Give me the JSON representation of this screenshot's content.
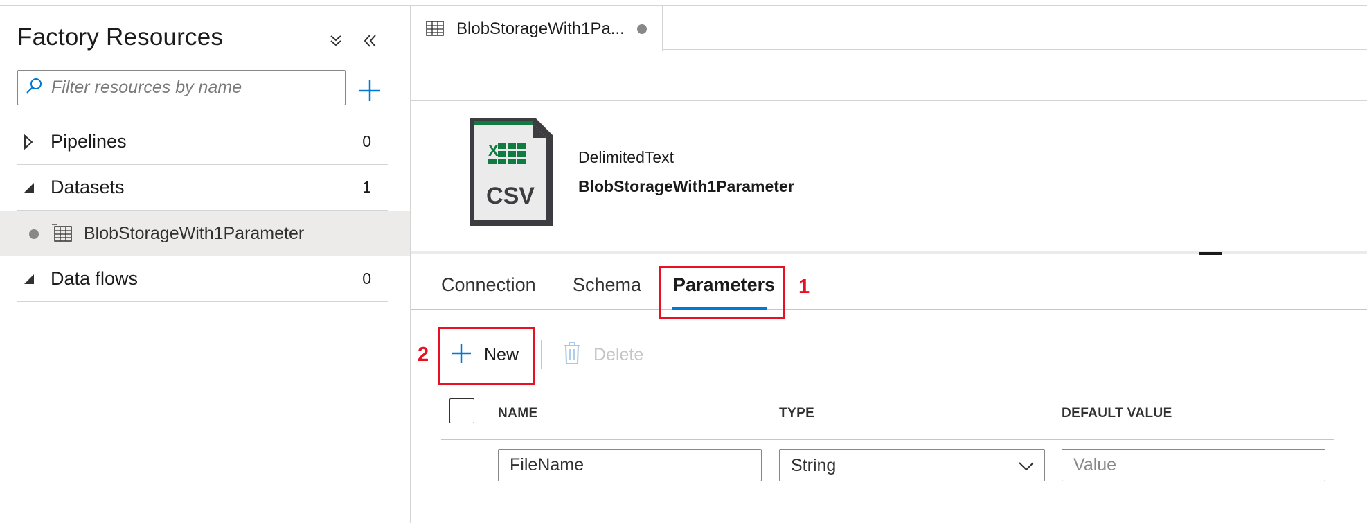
{
  "sidebar": {
    "title": "Factory Resources",
    "search_placeholder": "Filter resources by name",
    "sections": {
      "pipelines": {
        "label": "Pipelines",
        "count": "0"
      },
      "datasets": {
        "label": "Datasets",
        "count": "1"
      },
      "dataflows": {
        "label": "Data flows",
        "count": "0"
      }
    },
    "dataset_item": {
      "label": "BlobStorageWith1Parameter"
    }
  },
  "editor_tab": {
    "label": "BlobStorageWith1Pa..."
  },
  "dataset": {
    "icon_text": "CSV",
    "type": "DelimitedText",
    "name": "BlobStorageWith1Parameter"
  },
  "subtabs": {
    "connection": "Connection",
    "schema": "Schema",
    "parameters": "Parameters"
  },
  "annotations": {
    "one": "1",
    "two": "2"
  },
  "toolbar": {
    "new_label": "New",
    "delete_label": "Delete"
  },
  "grid": {
    "columns": {
      "name": "NAME",
      "type": "TYPE",
      "default": "DEFAULT VALUE"
    },
    "row": {
      "name_value": "FileName",
      "type_value": "String",
      "default_placeholder": "Value"
    }
  },
  "colors": {
    "accent": "#0078d4",
    "annotation": "#e81123",
    "excel_green": "#107c41",
    "selected_row_bg": "#edebe9"
  }
}
